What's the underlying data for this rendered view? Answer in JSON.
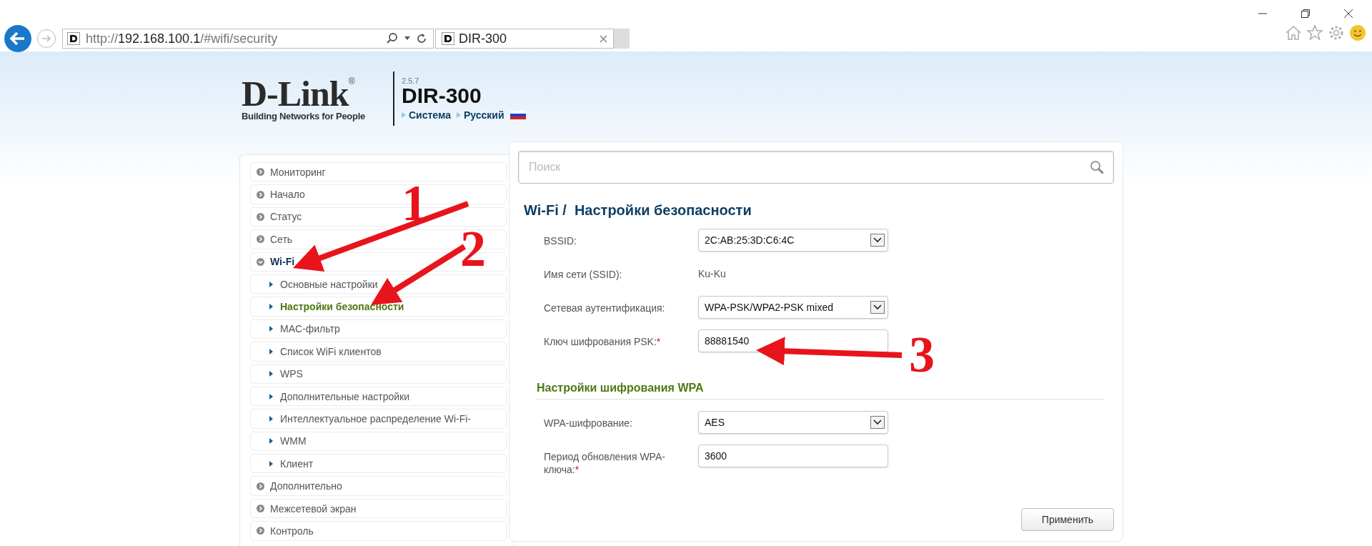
{
  "browser": {
    "url_scheme": "http://",
    "url_host": "192.168.100.1",
    "url_path": "/#wifi/security",
    "tab_title": "DIR-300"
  },
  "header": {
    "logo": "D-Link",
    "logo_mark": "®",
    "tagline": "Building Networks for People",
    "version": "2.5.7",
    "model": "DIR-300",
    "links": [
      "Система",
      "Русский"
    ]
  },
  "menu": [
    {
      "label": "Мониторинг",
      "expanded": false,
      "selected": false
    },
    {
      "label": "Начало",
      "expanded": false,
      "selected": false
    },
    {
      "label": "Статус",
      "expanded": false,
      "selected": false
    },
    {
      "label": "Сеть",
      "expanded": false,
      "selected": false
    },
    {
      "label": "Wi-Fi",
      "expanded": true,
      "selected": false,
      "children": [
        {
          "label": "Основные настройки",
          "selected": false
        },
        {
          "label": "Настройки безопасности",
          "selected": true
        },
        {
          "label": "MAC-фильтр",
          "selected": false
        },
        {
          "label": "Список WiFi клиентов",
          "selected": false
        },
        {
          "label": "WPS",
          "selected": false
        },
        {
          "label": "Дополнительные настройки",
          "selected": false
        },
        {
          "label": "Интеллектуальное распределение Wi-Fi-",
          "selected": false
        },
        {
          "label": "WMM",
          "selected": false
        },
        {
          "label": "Клиент",
          "selected": false
        }
      ]
    },
    {
      "label": "Дополнительно",
      "expanded": false,
      "selected": false
    },
    {
      "label": "Межсетевой экран",
      "expanded": false,
      "selected": false
    },
    {
      "label": "Контроль",
      "expanded": false,
      "selected": false
    }
  ],
  "search": {
    "placeholder": "Поиск"
  },
  "title": {
    "section": "Wi-Fi /",
    "page": "Настройки безопасности"
  },
  "fields": [
    {
      "kind": "select",
      "label": "BSSID:",
      "value": "2C:AB:25:3D:C6:4C"
    },
    {
      "kind": "text",
      "label": "Имя сети (SSID):",
      "value": "Ku-Ku"
    },
    {
      "kind": "select",
      "label": "Сетевая аутентификация:",
      "value": "WPA-PSK/WPA2-PSK mixed"
    },
    {
      "kind": "input",
      "label": "Ключ шифрования PSK:",
      "mark": "*",
      "value": "88881540"
    }
  ],
  "wpa": {
    "heading": "Настройки шифрования WPA",
    "fields": [
      {
        "kind": "select",
        "label": "WPA-шифрование:",
        "value": "AES"
      },
      {
        "kind": "input",
        "label": "Период обновления WPA-ключа:",
        "mark": "*",
        "value": "3600"
      }
    ]
  },
  "apply_button": "Применить",
  "annotations": [
    {
      "label": "1"
    },
    {
      "label": "2"
    },
    {
      "label": "3"
    }
  ]
}
